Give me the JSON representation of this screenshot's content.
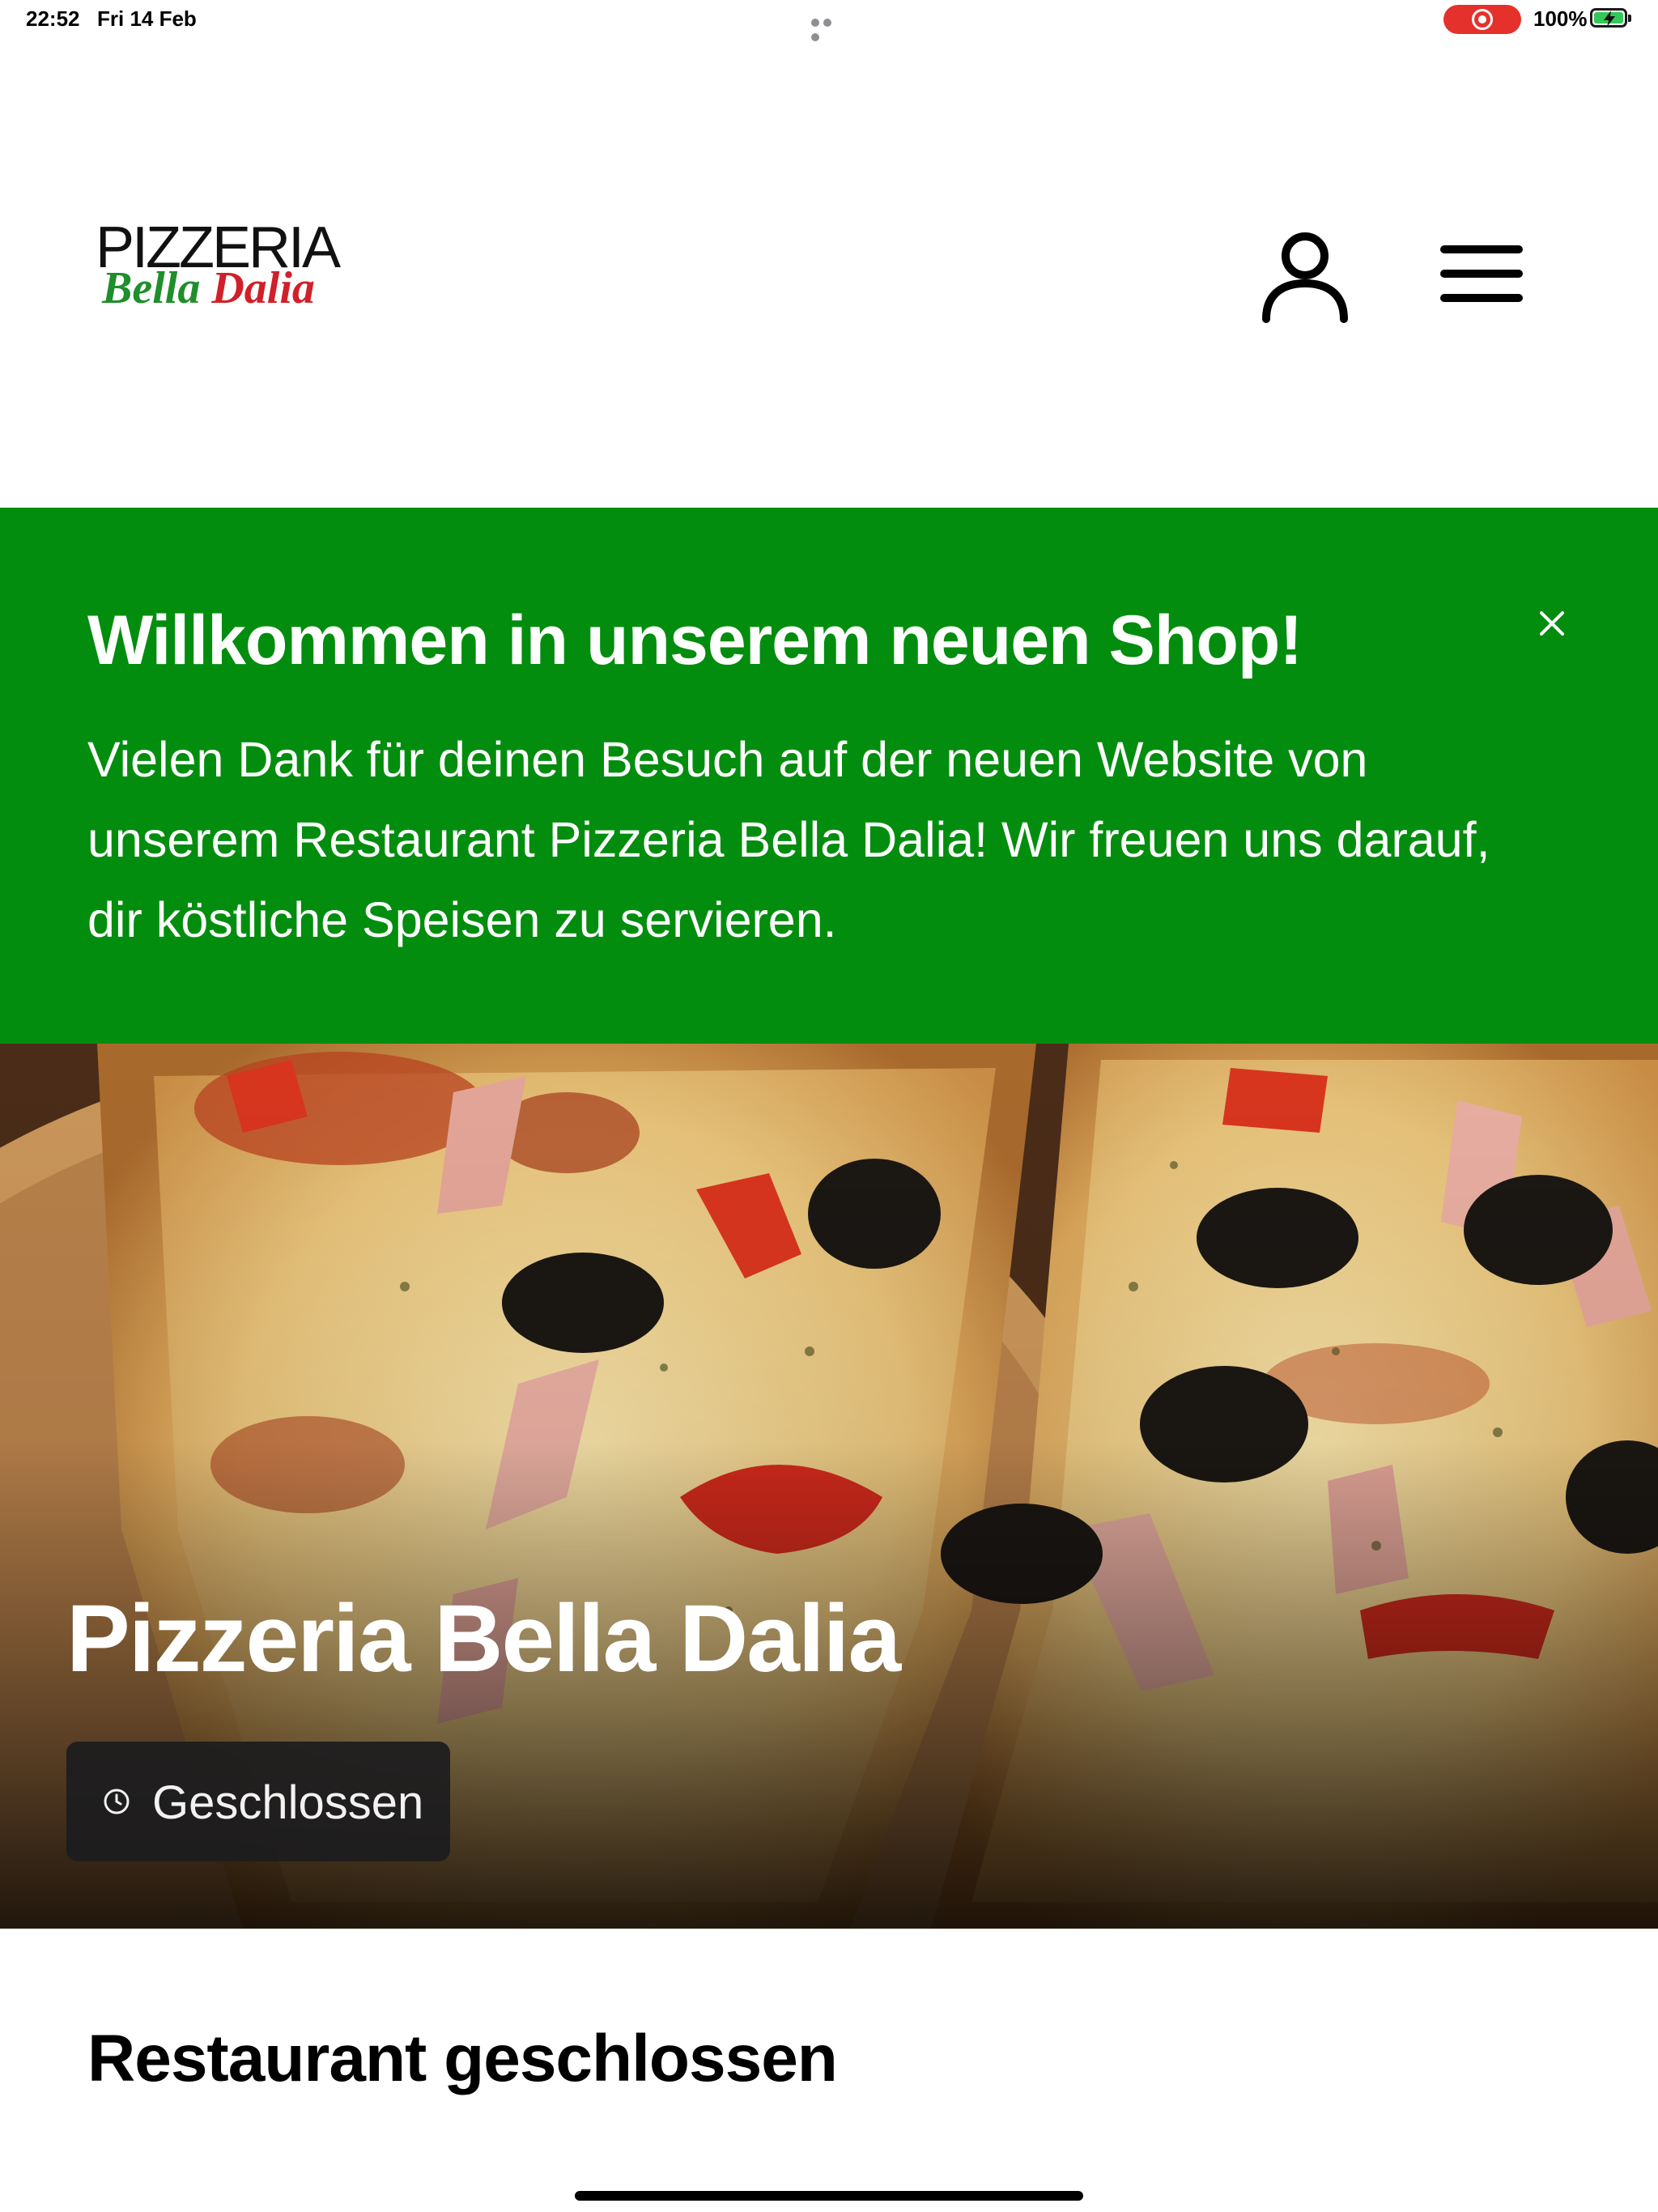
{
  "status_bar": {
    "time": "22:52",
    "date": "Fri 14 Feb",
    "battery": "100%",
    "recording_color": "#e5312b"
  },
  "header": {
    "logo_line1": "PIZZERIA",
    "logo_word1": "Bella",
    "logo_word2": "Dalia",
    "user_icon": "user-icon",
    "menu_icon": "hamburger-menu-icon"
  },
  "banner": {
    "title": "Willkommen in unserem neuen Shop!",
    "text": "Vielen Dank für deinen Besuch auf der neuen Website von unserem Restaurant Pizzeria Bella Dalia! Wir freuen uns darauf, dir köstliche Speisen zu servieren.",
    "background": "#038d0e",
    "close_icon": "close-icon"
  },
  "hero": {
    "restaurant_name": "Pizzeria Bella Dalia",
    "status": "Geschlossen",
    "status_icon": "clock-icon"
  },
  "section": {
    "title": "Restaurant geschlossen"
  }
}
